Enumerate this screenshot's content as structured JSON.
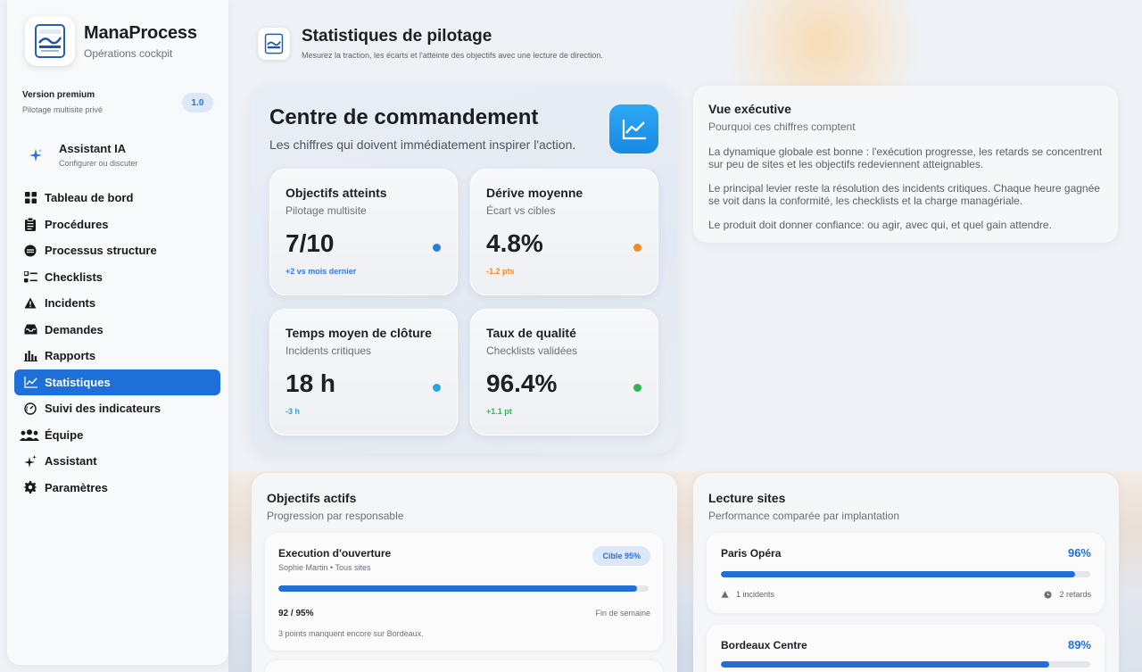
{
  "brand": {
    "name": "ManaProcess",
    "subtitle": "Opérations cockpit"
  },
  "premium": {
    "title": "Version premium",
    "subtitle": "Pilotage multisite privé",
    "version": "1.0"
  },
  "assistant": {
    "title": "Assistant IA",
    "subtitle": "Configurer ou discuter"
  },
  "nav": {
    "items": [
      {
        "label": "Tableau de bord",
        "icon": "grid-icon"
      },
      {
        "label": "Procédures",
        "icon": "clipboard-icon"
      },
      {
        "label": "Processus structure",
        "icon": "layers-icon"
      },
      {
        "label": "Checklists",
        "icon": "checklist-icon"
      },
      {
        "label": "Incidents",
        "icon": "warning-icon"
      },
      {
        "label": "Demandes",
        "icon": "inbox-icon"
      },
      {
        "label": "Rapports",
        "icon": "bar-chart-icon"
      },
      {
        "label": "Statistiques",
        "icon": "line-chart-icon",
        "active": true
      },
      {
        "label": "Suivi des indicateurs",
        "icon": "gauge-icon"
      },
      {
        "label": "Équipe",
        "icon": "team-icon"
      },
      {
        "label": "Assistant",
        "icon": "sparkles-icon"
      },
      {
        "label": "Paramètres",
        "icon": "gear-icon"
      }
    ]
  },
  "header": {
    "title": "Statistiques de pilotage",
    "subtitle": "Mesurez la traction, les écarts et l'atteinte des objectifs avec une lecture de direction."
  },
  "command": {
    "title": "Centre de commandement",
    "subtitle": "Les chiffres qui doivent immédiatement inspirer l'action.",
    "kpis": [
      {
        "title": "Objectifs atteints",
        "subtitle": "Pilotage multisite",
        "value": "7/10",
        "delta": "+2 vs mois dernier",
        "color": "#2a7de1"
      },
      {
        "title": "Dérive moyenne",
        "subtitle": "Écart vs cibles",
        "value": "4.8%",
        "delta": "-1.2 pts",
        "color": "#f28a2e"
      },
      {
        "title": "Temps moyen de clôture",
        "subtitle": "Incidents critiques",
        "value": "18 h",
        "delta": "-3 h",
        "color": "#28a8dc"
      },
      {
        "title": "Taux de qualité",
        "subtitle": "Checklists validées",
        "value": "96.4%",
        "delta": "+1.1 pt",
        "color": "#34b45a"
      }
    ]
  },
  "executive": {
    "title": "Vue exécutive",
    "subtitle": "Pourquoi ces chiffres comptent",
    "paragraphs": [
      "La dynamique globale est bonne : l'exécution progresse, les retards se concentrent sur peu de sites et les objectifs redeviennent atteignables.",
      "Le principal levier reste la résolution des incidents critiques. Chaque heure gagnée se voit dans la conformité, les checklists et la charge managériale.",
      "Le produit doit donner confiance: ou agir, avec qui, et quel gain attendre."
    ]
  },
  "objectives": {
    "title": "Objectifs actifs",
    "subtitle": "Progression par responsable",
    "items": [
      {
        "title": "Execution d'ouverture",
        "meta": "Sophie Martin • Tous sites",
        "badge": "Cible 95%",
        "progress": 0.968,
        "progress_label": "92 / 95%",
        "deadline": "Fin de semaine",
        "note": "3 points manquent encore sur Bordeaux."
      }
    ]
  },
  "sites": {
    "title": "Lecture sites",
    "subtitle": "Performance comparée par implantation",
    "items": [
      {
        "name": "Paris Opéra",
        "pct": "96%",
        "progress": 0.96,
        "incidents": "1 incidents",
        "delays": "2 retards"
      },
      {
        "name": "Bordeaux Centre",
        "pct": "89%",
        "progress": 0.89
      }
    ]
  },
  "colors": {
    "accent": "#1f6fd9",
    "badge_bg": "#dce8f7"
  }
}
